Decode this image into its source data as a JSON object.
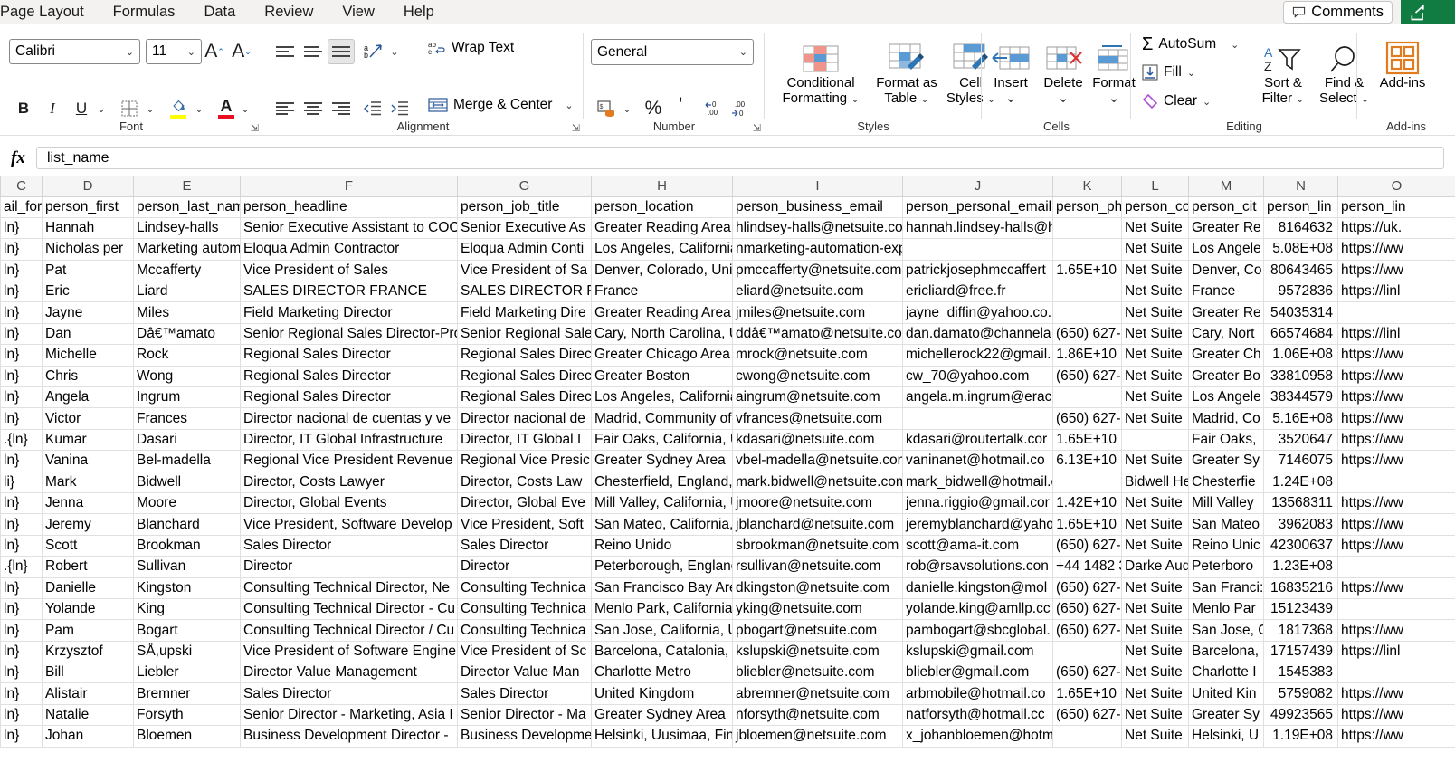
{
  "tabs": [
    "Page Layout",
    "Formulas",
    "Data",
    "Review",
    "View",
    "Help"
  ],
  "titlebar": {
    "comments_label": "Comments",
    "comments_icon": "comment-icon"
  },
  "ribbon": {
    "font": {
      "group_label": "Font",
      "font_name": "Calibri",
      "font_size": "11",
      "grow_font": "A",
      "shrink_font": "A",
      "bold": "B",
      "italic": "I",
      "underline": "U",
      "borders_icon": "borders-icon",
      "fill_color_icon": "fill-color-icon",
      "font_color_icon": "font-color-icon"
    },
    "alignment": {
      "group_label": "Alignment",
      "orientation_icon": "orientation-icon",
      "wrap_text": "Wrap Text",
      "merge_center": "Merge & Center",
      "wrap_icon": "wrap-text-icon",
      "merge_icon": "merge-center-icon",
      "decrease_indent_icon": "decrease-indent-icon",
      "increase_indent_icon": "increase-indent-icon"
    },
    "number": {
      "group_label": "Number",
      "format": "General",
      "accounting_icon": "accounting-format-icon",
      "percent": "%",
      "comma": "'",
      "decrease_decimal": "decrease-decimal-icon",
      "increase_decimal": "increase-decimal-icon"
    },
    "styles": {
      "group_label": "Styles",
      "conditional_formatting": "Conditional\nFormatting",
      "cf_line1": "Conditional",
      "cf_line2": "Formatting",
      "format_as_table_1": "Format as",
      "format_as_table_2": "Table",
      "cell_styles_1": "Cell",
      "cell_styles_2": "Styles"
    },
    "cells": {
      "group_label": "Cells",
      "insert": "Insert",
      "delete": "Delete",
      "format": "Format"
    },
    "editing": {
      "group_label": "Editing",
      "autosum": "AutoSum",
      "fill": "Fill",
      "clear": "Clear",
      "sort_filter_1": "Sort &",
      "sort_filter_2": "Filter",
      "find_select_1": "Find &",
      "find_select_2": "Select"
    },
    "addins": {
      "group_label": "Add-ins",
      "label": "Add-ins"
    }
  },
  "formula_bar": {
    "fx": "fx",
    "value": "list_name"
  },
  "grid": {
    "column_letters": [
      "C",
      "D",
      "E",
      "F",
      "G",
      "H",
      "I",
      "J",
      "K",
      "L",
      "M",
      "N",
      "O"
    ],
    "headers": [
      "ail_form",
      "person_first",
      "person_last_nam",
      "person_headline",
      "person_job_title",
      "person_location",
      "person_business_email",
      "person_personal_email",
      "person_ph",
      "person_co",
      "person_cit",
      "person_lin",
      "person_lin"
    ],
    "rows": [
      [
        "ln}",
        "Hannah",
        "Lindsey-halls",
        "Senior Executive Assistant to COO",
        "Senior Executive As",
        "Greater Reading Area",
        "hlindsey-halls@netsuite.com",
        "hannah.lindsey-halls@hotmail.co.",
        "",
        "Net Suite",
        "Greater Re",
        "8164632",
        "https://uk."
      ],
      [
        "ln}",
        "Nicholas per",
        "Marketing autom",
        "Eloqua Admin Contractor",
        "Eloqua Admin Conti",
        "Los Angeles, California,",
        "nmarketing-automation-expert@netsuite.com",
        "",
        "",
        "Net Suite",
        "Los Angele",
        "5.08E+08",
        "https://ww"
      ],
      [
        "ln}",
        "Pat",
        "Mccafferty",
        "Vice President of Sales",
        "Vice President of Sa",
        "Denver, Colorado, Unit",
        "pmccafferty@netsuite.com",
        "patrickjosephmccaffert",
        "1.65E+10",
        "Net Suite",
        "Denver, Co",
        "80643465",
        "https://ww"
      ],
      [
        "ln}",
        "Eric",
        "Liard",
        "SALES DIRECTOR FRANCE",
        "SALES DIRECTOR FR",
        "France",
        "eliard@netsuite.com",
        "ericliard@free.fr",
        "",
        "Net Suite",
        "France",
        "9572836",
        "https://linl"
      ],
      [
        "ln}",
        "Jayne",
        "Miles",
        "Field Marketing Director",
        "Field Marketing Dire",
        "Greater Reading Area",
        "jmiles@netsuite.com",
        "jayne_diffin@yahoo.co.uk",
        "",
        "Net Suite",
        "Greater Re",
        "54035314",
        ""
      ],
      [
        "ln}",
        "Dan",
        "Dâ€™amato",
        "Senior Regional Sales Director-Pro",
        "Senior Regional Sale",
        "Cary, North Carolina, U",
        "ddâ€™amato@netsuite.com",
        "dan.damato@channela",
        "(650) 627-",
        "Net Suite",
        "Cary, Nort",
        "66574684",
        "https://linl"
      ],
      [
        "ln}",
        "Michelle",
        "Rock",
        "Regional Sales Director",
        "Regional Sales Direc",
        "Greater Chicago Area",
        "mrock@netsuite.com",
        "michellerock22@gmail.",
        "1.86E+10",
        "Net Suite",
        "Greater Ch",
        "1.06E+08",
        "https://ww"
      ],
      [
        "ln}",
        "Chris",
        "Wong",
        "Regional Sales Director",
        "Regional Sales Direc",
        "Greater Boston",
        "cwong@netsuite.com",
        "cw_70@yahoo.com",
        "(650) 627-",
        "Net Suite",
        "Greater Bo",
        "33810958",
        "https://ww"
      ],
      [
        "ln}",
        "Angela",
        "Ingrum",
        "Regional Sales Director",
        "Regional Sales Direc",
        "Los Angeles, California,",
        "aingrum@netsuite.com",
        "angela.m.ingrum@erac.com",
        "",
        "Net Suite",
        "Los Angele",
        "38344579",
        "https://ww"
      ],
      [
        "ln}",
        "Victor",
        "Frances",
        "Director nacional de cuentas y ve",
        "Director nacional de",
        "Madrid, Community of",
        "vfrances@netsuite.com",
        "",
        "(650) 627-",
        "Net Suite",
        "Madrid, Co",
        "5.16E+08",
        "https://ww"
      ],
      [
        ".{ln}",
        "Kumar",
        "Dasari",
        "Director, IT Global Infrastructure",
        "Director, IT Global I",
        "Fair Oaks, California, U",
        "kdasari@netsuite.com",
        "kdasari@routertalk.cor",
        "1.65E+10",
        "",
        "Fair Oaks,",
        "3520647",
        "https://ww"
      ],
      [
        "ln}",
        "Vanina",
        "Bel-madella",
        "Regional Vice President Revenue",
        "Regional Vice Presic",
        "Greater Sydney Area",
        "vbel-madella@netsuite.com",
        "vaninanet@hotmail.co",
        "6.13E+10",
        "Net Suite",
        "Greater Sy",
        "7146075",
        "https://ww"
      ],
      [
        "li}",
        "Mark",
        "Bidwell",
        "Director, Costs Lawyer",
        "Director, Costs Law",
        "Chesterfield, England, U",
        "mark.bidwell@netsuite.com",
        "mark_bidwell@hotmail.com",
        "",
        "Bidwell He",
        "Chesterfie",
        "1.24E+08",
        ""
      ],
      [
        "ln}",
        "Jenna",
        "Moore",
        "Director, Global Events",
        "Director, Global Eve",
        "Mill Valley, California, U",
        "jmoore@netsuite.com",
        "jenna.riggio@gmail.cor",
        "1.42E+10",
        "Net Suite",
        "Mill Valley",
        "13568311",
        "https://ww"
      ],
      [
        "ln}",
        "Jeremy",
        "Blanchard",
        "Vice President, Software Develop",
        "Vice President, Soft",
        "San Mateo, California,",
        "jblanchard@netsuite.com",
        "jeremyblanchard@yaho",
        "1.65E+10",
        "Net Suite",
        "San Mateo",
        "3962083",
        "https://ww"
      ],
      [
        "ln}",
        "Scott",
        "Brookman",
        "Sales Director",
        "Sales Director",
        "Reino Unido",
        "sbrookman@netsuite.com",
        "scott@ama-it.com",
        "(650) 627-",
        "Net Suite",
        "Reino Unic",
        "42300637",
        "https://ww"
      ],
      [
        ".{ln}",
        "Robert",
        "Sullivan",
        "Director",
        "Director",
        "Peterborough, England",
        "rsullivan@netsuite.com",
        "rob@rsavsolutions.con",
        "+44 1482 3",
        "Darke Aud",
        "Peterboro",
        "1.23E+08",
        ""
      ],
      [
        "ln}",
        "Danielle",
        "Kingston",
        "Consulting Technical Director, Ne",
        "Consulting Technica",
        "San Francisco Bay Area",
        "dkingston@netsuite.com",
        "danielle.kingston@mol",
        "(650) 627-",
        "Net Suite",
        "San Franci:",
        "16835216",
        "https://ww"
      ],
      [
        "ln}",
        "Yolande",
        "King",
        "Consulting Technical Director - Cu",
        "Consulting Technica",
        "Menlo Park, California,",
        "yking@netsuite.com",
        "yolande.king@amllp.cc",
        "(650) 627-",
        "Net Suite",
        "Menlo Par",
        "15123439",
        ""
      ],
      [
        "ln}",
        "Pam",
        "Bogart",
        "Consulting Technical Director / Cu",
        "Consulting Technica",
        "San Jose, California, Un",
        "pbogart@netsuite.com",
        "pambogart@sbcglobal.",
        "(650) 627-",
        "Net Suite",
        "San Jose, C",
        "1817368",
        "https://ww"
      ],
      [
        "ln}",
        "Krzysztof",
        "SÅ,upski",
        "Vice President of Software Engine",
        "Vice President of Sc",
        "Barcelona, Catalonia, S",
        "kslupski@netsuite.com",
        "kslupski@gmail.com",
        "",
        "Net Suite",
        "Barcelona,",
        "17157439",
        "https://linl"
      ],
      [
        "ln}",
        "Bill",
        "Liebler",
        "Director Value Management",
        "Director Value Man",
        "Charlotte Metro",
        "bliebler@netsuite.com",
        "bliebler@gmail.com",
        "(650) 627-",
        "Net Suite",
        "Charlotte I",
        "1545383",
        ""
      ],
      [
        "ln}",
        "Alistair",
        "Bremner",
        "Sales Director",
        "Sales Director",
        "United Kingdom",
        "abremner@netsuite.com",
        "arbmobile@hotmail.co",
        "1.65E+10",
        "Net Suite",
        "United Kin",
        "5759082",
        "https://ww"
      ],
      [
        "ln}",
        "Natalie",
        "Forsyth",
        "Senior Director - Marketing, Asia I",
        "Senior Director - Ma",
        "Greater Sydney Area",
        "nforsyth@netsuite.com",
        "natforsyth@hotmail.cc",
        "(650) 627-",
        "Net Suite",
        "Greater Sy",
        "49923565",
        "https://ww"
      ],
      [
        "ln}",
        "Johan",
        "Bloemen",
        "Business Development Director -",
        "Business Developme",
        "Helsinki, Uusimaa, Finla",
        "jbloemen@netsuite.com",
        "x_johanbloemen@hotmail.com",
        "",
        "Net Suite",
        "Helsinki, U",
        "1.19E+08",
        "https://ww"
      ]
    ]
  }
}
